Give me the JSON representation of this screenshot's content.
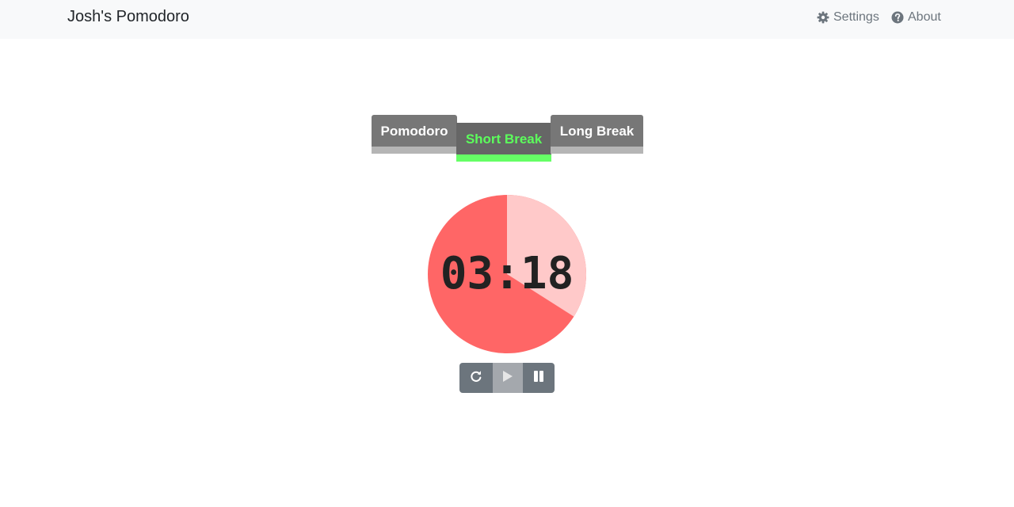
{
  "app": {
    "title": "Josh's Pomodoro"
  },
  "nav": {
    "settings_label": "Settings",
    "about_label": "About",
    "settings_icon": "gear-icon",
    "about_icon": "question-circle-icon"
  },
  "tabs": [
    {
      "label": "Pomodoro",
      "active": false
    },
    {
      "label": "Short Break",
      "active": true
    },
    {
      "label": "Long Break",
      "active": false
    }
  ],
  "timer": {
    "display": "03:18",
    "elapsed_fraction": 0.34,
    "colors": {
      "remaining": "#ff6666",
      "elapsed": "#ffc9c9"
    }
  },
  "controls": {
    "reset_icon": "rotate-right-icon",
    "play_icon": "play-icon",
    "pause_icon": "pause-icon",
    "play_disabled": true
  },
  "colors": {
    "active_tab_accent": "#66ff66",
    "tab_bg": "#777777"
  }
}
